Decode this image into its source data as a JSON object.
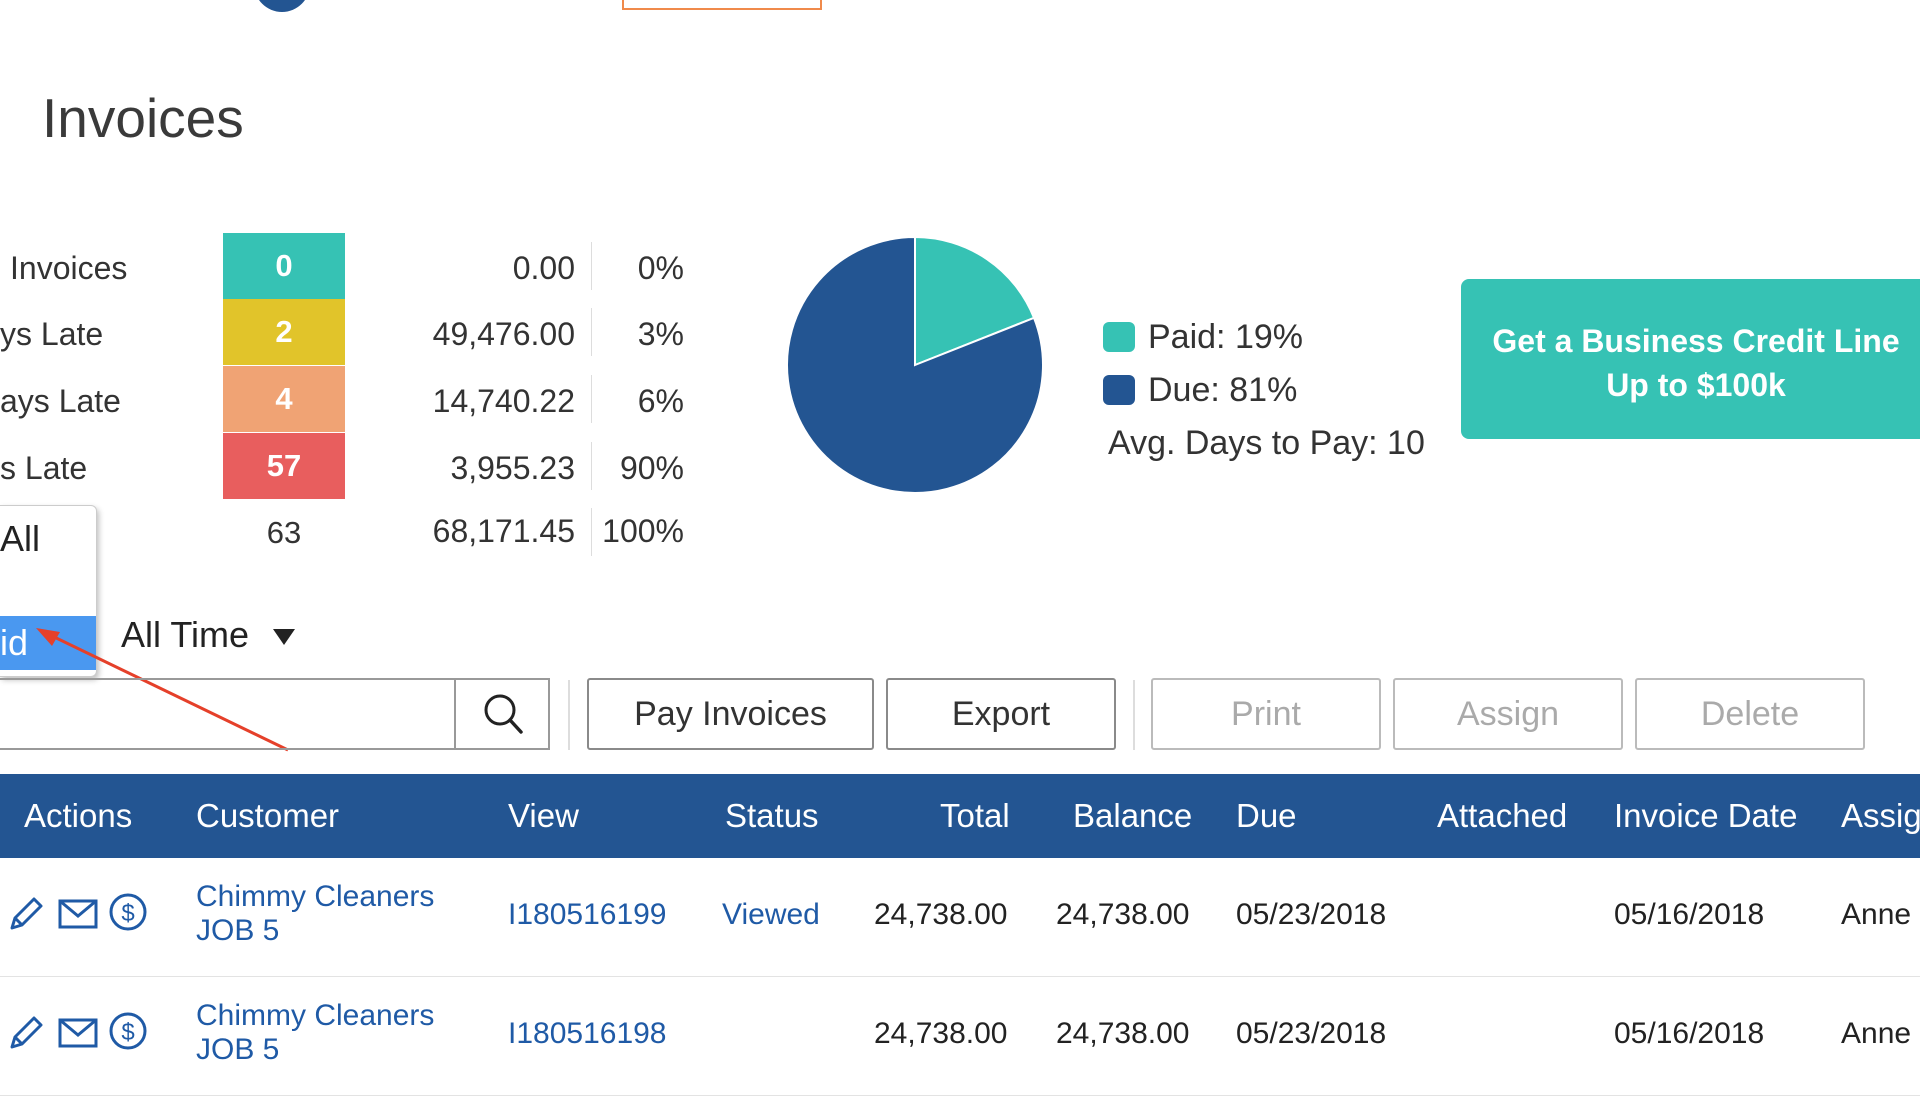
{
  "page": {
    "title": "Invoices"
  },
  "summary": {
    "rows": [
      {
        "label": "Invoices",
        "count": "0",
        "amount": "0.00",
        "percent": "0%",
        "color": "#36c2b4"
      },
      {
        "label": "ys Late",
        "count": "2",
        "amount": "49,476.00",
        "percent": "3%",
        "color": "#e1c42a"
      },
      {
        "label": "ays Late",
        "count": "4",
        "amount": "14,740.22",
        "percent": "6%",
        "color": "#f0a374"
      },
      {
        "label": "s Late",
        "count": "57",
        "amount": "3,955.23",
        "percent": "90%",
        "color": "#e85e5e"
      }
    ],
    "total": {
      "count": "63",
      "amount": "68,171.45",
      "percent": "100%"
    }
  },
  "chart_data": {
    "type": "pie",
    "slices": [
      {
        "label": "Paid",
        "value": 19,
        "color": "#36c2b4"
      },
      {
        "label": "Due",
        "value": 81,
        "color": "#235592"
      }
    ],
    "legend": {
      "paid": "Paid: 19%",
      "due": "Due: 81%"
    },
    "avg_days": "Avg. Days to Pay: 10"
  },
  "cta": {
    "line1": "Get a Business Credit Line",
    "line2": "Up to $100k"
  },
  "filter": {
    "dropdown_options": [
      "All",
      "id"
    ],
    "period": "All Time"
  },
  "toolbar": {
    "pay_invoices": "Pay Invoices",
    "export": "Export",
    "print": "Print",
    "assign": "Assign",
    "delete": "Delete"
  },
  "table": {
    "headers": [
      "Actions",
      "Customer",
      "View",
      "Status",
      "Total",
      "Balance",
      "Due",
      "Attached",
      "Invoice Date",
      "Assig"
    ],
    "rows": [
      {
        "customer1": "Chimmy Cleaners",
        "customer2": "JOB 5",
        "view": "I180516199",
        "status": "Viewed",
        "total": "24,738.00",
        "balance": "24,738.00",
        "due": "05/23/2018",
        "attached": "",
        "invoice_date": "05/16/2018",
        "assigned": "Anne"
      },
      {
        "customer1": "Chimmy Cleaners",
        "customer2": "JOB 5",
        "view": "I180516198",
        "status": "",
        "total": "24,738.00",
        "balance": "24,738.00",
        "due": "05/23/2018",
        "attached": "",
        "invoice_date": "05/16/2018",
        "assigned": "Anne"
      }
    ]
  },
  "colors": {
    "header_bg": "#235592",
    "accent": "#36c2b4",
    "selection": "#4a98f0",
    "arrow": "#e5402a"
  }
}
